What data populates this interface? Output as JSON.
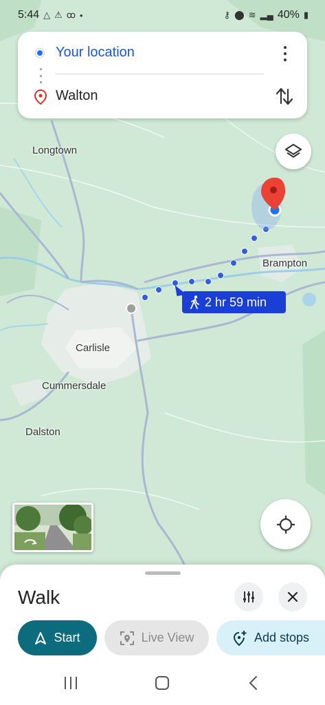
{
  "status_bar": {
    "time": "5:44",
    "battery": "40%"
  },
  "route": {
    "origin": "Your location",
    "destination": "Walton"
  },
  "map": {
    "places": [
      "Longtown",
      "Brampton",
      "Carlisle",
      "Cummersdale",
      "Dalston"
    ],
    "duration": "2 hr 59 min"
  },
  "sheet": {
    "mode": "Walk",
    "start_label": "Start",
    "live_view_label": "Live View",
    "add_stops_label": "Add stops"
  },
  "colors": {
    "route_blue": "#2f5fe0",
    "chip_blue": "#1a3fd6",
    "start_teal": "#0d6b7e",
    "pin_red": "#ea4335"
  },
  "icons": {
    "layers": "layers-icon",
    "recenter": "crosshair-icon",
    "swap": "swap-icon",
    "options": "sliders-icon",
    "close": "close-icon",
    "walk": "walk-icon",
    "navigate": "navigation-arrow-icon",
    "live_view": "live-view-icon",
    "add_stop": "add-location-icon"
  }
}
